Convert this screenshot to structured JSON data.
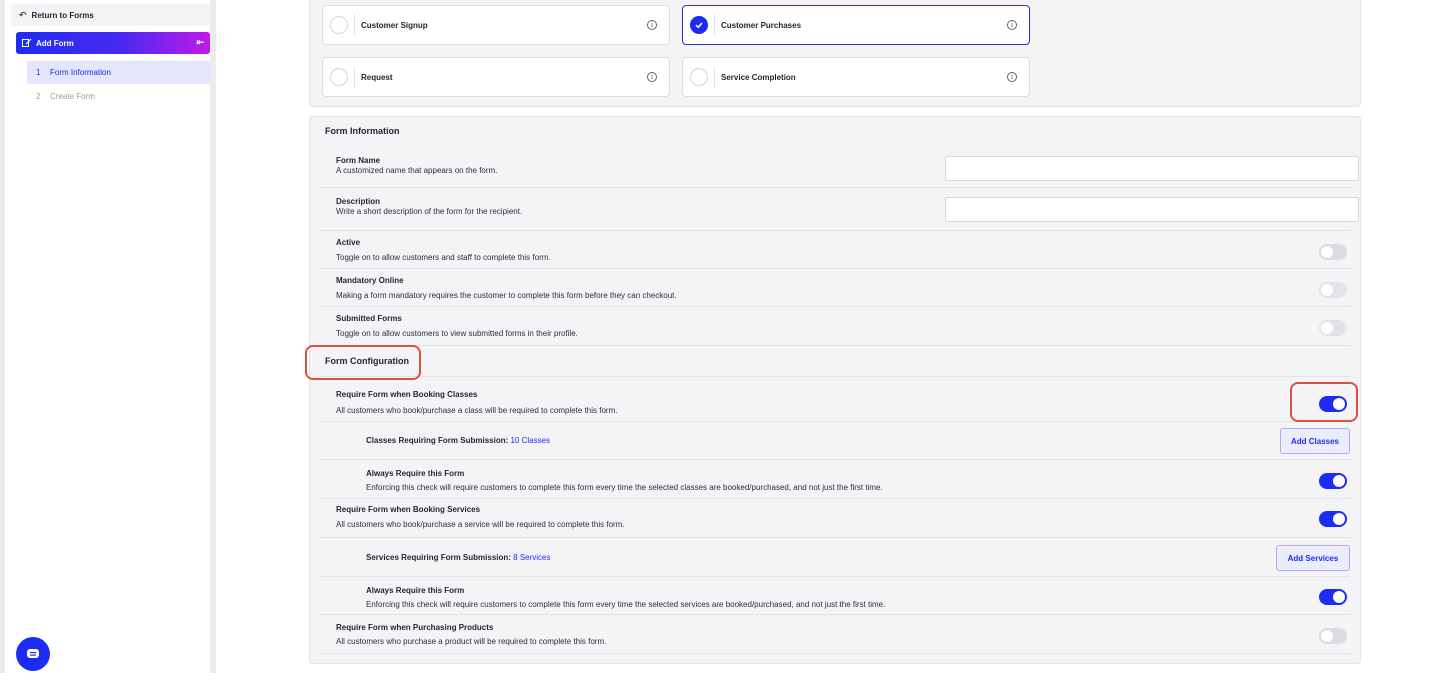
{
  "sidebar": {
    "back_label": "Return to Forms",
    "section_label": "Add Form",
    "steps": [
      {
        "num": "1",
        "label": "Form Information"
      },
      {
        "num": "2",
        "label": "Create Form"
      }
    ]
  },
  "form_types": [
    {
      "label": "Customer Signup",
      "selected": false
    },
    {
      "label": "Customer Purchases",
      "selected": true
    },
    {
      "label": "Request",
      "selected": false
    },
    {
      "label": "Service Completion",
      "selected": false
    }
  ],
  "form_information": {
    "title": "Form Information",
    "form_name": {
      "title": "Form Name",
      "desc": "A customized name that appears on the form.",
      "value": ""
    },
    "description": {
      "title": "Description",
      "desc": "Write a short description of the form for the recipient.",
      "value": ""
    },
    "active": {
      "title": "Active",
      "desc": "Toggle on to allow customers and staff to complete this form.",
      "on": false
    },
    "mandatory_online": {
      "title": "Mandatory Online",
      "desc": "Making a form mandatory requires the customer to complete this form before they can checkout.",
      "on": false
    },
    "submitted_forms": {
      "title": "Submitted Forms",
      "desc": "Toggle on to allow customers to view submitted forms in their profile.",
      "on": false
    }
  },
  "form_configuration": {
    "title": "Form Configuration",
    "booking_classes": {
      "title": "Require Form when Booking Classes",
      "desc": "All customers who book/purchase a class will be required to complete this form.",
      "on": true
    },
    "classes_requiring": {
      "label": "Classes Requiring Form Submission:",
      "link": "10 Classes",
      "button": "Add Classes"
    },
    "always_classes": {
      "title": "Always Require this Form",
      "desc": "Enforcing this check will require customers to complete this form every time the selected classes are booked/purchased, and not just the first time.",
      "on": true
    },
    "booking_services": {
      "title": "Require Form when Booking Services",
      "desc": "All customers who book/purchase a service will be required to complete this form.",
      "on": true
    },
    "services_requiring": {
      "label": "Services Requiring Form Submission:",
      "link": "8 Services",
      "button": "Add Services"
    },
    "always_services": {
      "title": "Always Require this Form",
      "desc": "Enforcing this check will require customers to complete this form every time the selected services are booked/purchased, and not just the first time.",
      "on": true
    },
    "purchasing_products": {
      "title": "Require Form when Purchasing Products",
      "desc": "All customers who purchase a product will be required to complete this form.",
      "on": false
    }
  },
  "colors": {
    "accent": "#1d2cf5",
    "highlight": "#d9523f",
    "panel": "#f4f4f6"
  }
}
